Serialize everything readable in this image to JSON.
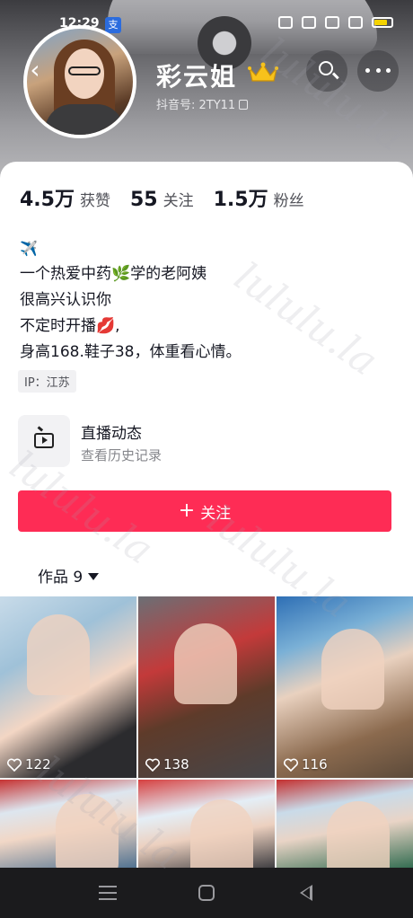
{
  "status_bar": {
    "time": "12:29",
    "app_badge": "支"
  },
  "header": {
    "back_glyph": "‹",
    "nickname": "彩云姐",
    "douyin_id": "抖音号: 2TY11"
  },
  "stats": [
    {
      "value": "4.5万",
      "label": "获赞"
    },
    {
      "value": "55",
      "label": "关注"
    },
    {
      "value": "1.5万",
      "label": "粉丝"
    }
  ],
  "bio": {
    "line1": "✈️",
    "line2_a": "一个热爱中药",
    "line2_emoji": "🌿",
    "line2_b": "学的老阿姨",
    "line3": "很高兴认识你",
    "line4_a": "不定时开播",
    "line4_emoji": "💋",
    "line4_b": ",",
    "line5": "身高168.鞋子38，体重看心情。"
  },
  "ip_tag": "IP：江苏",
  "live": {
    "title": "直播动态",
    "subtitle": "查看历史记录"
  },
  "follow_button": {
    "plus": "+",
    "label": "关注"
  },
  "works_tab": {
    "label": "作品 9"
  },
  "videos": [
    {
      "likes": "122"
    },
    {
      "likes": "138"
    },
    {
      "likes": "116"
    },
    {
      "likes": ""
    },
    {
      "likes": ""
    },
    {
      "likes": ""
    }
  ],
  "watermark": "lululu.la",
  "colors": {
    "accent": "#fe2c55",
    "text": "#161823",
    "secondary": "#86878c"
  },
  "icons": [
    "back-icon",
    "search-icon",
    "more-icon",
    "crown-icon",
    "copy-icon",
    "live-tv-icon",
    "heart-icon",
    "nav-menu-icon",
    "nav-home-icon",
    "nav-back-icon"
  ]
}
